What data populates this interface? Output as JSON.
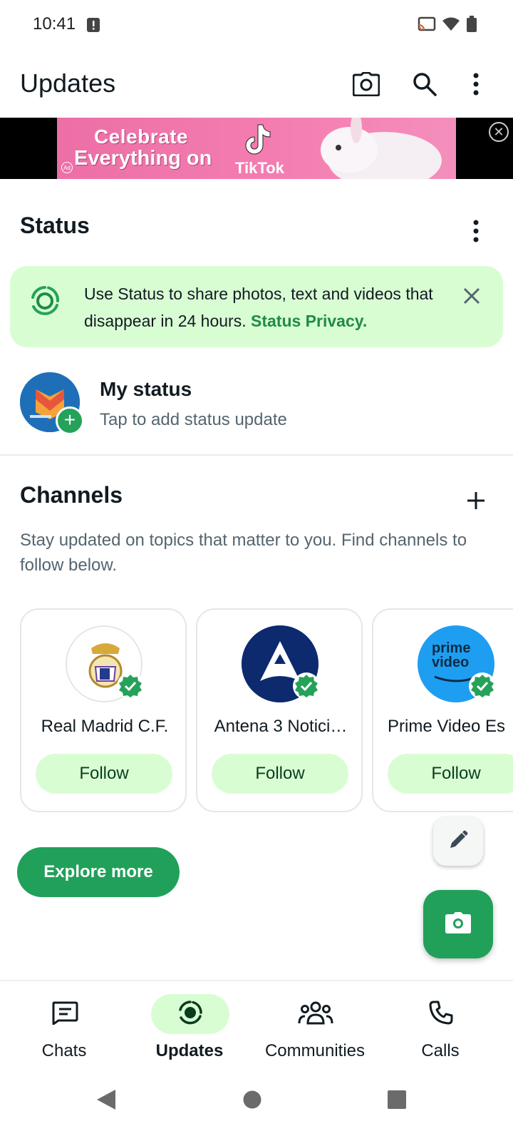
{
  "status_bar": {
    "time": "10:41"
  },
  "app_bar": {
    "title": "Updates",
    "icons": [
      "camera-icon",
      "search-icon",
      "more-vert-icon"
    ]
  },
  "ad_banner": {
    "line1": "Celebrate",
    "line2": "Everything on",
    "brand": "TikTok",
    "ad_badge": "Ad"
  },
  "status_section": {
    "title": "Status",
    "tip": {
      "text": "Use Status to share photos, text and videos that disappear in 24 hours. ",
      "link": "Status Privacy."
    },
    "my_status": {
      "name": "My status",
      "subtitle": "Tap to add status update"
    }
  },
  "channels_section": {
    "title": "Channels",
    "description": "Stay updated on topics that matter to you. Find channels to follow below.",
    "cards": [
      {
        "name": "Real Madrid C.F.",
        "follow_label": "Follow"
      },
      {
        "name": "Antena 3 Notici…",
        "follow_label": "Follow"
      },
      {
        "name": "Prime Video Es",
        "follow_label": "Follow",
        "logo_text": "prime video"
      }
    ],
    "explore_label": "Explore more"
  },
  "bottom_nav": {
    "items": [
      {
        "label": "Chats",
        "active": false
      },
      {
        "label": "Updates",
        "active": true
      },
      {
        "label": "Communities",
        "active": false
      },
      {
        "label": "Calls",
        "active": false
      }
    ]
  },
  "colors": {
    "accent": "#21a05a",
    "accent_light": "#d9fdd3",
    "link_green": "#1f8a4c",
    "text_primary": "#111b21",
    "text_secondary": "#54656f"
  }
}
